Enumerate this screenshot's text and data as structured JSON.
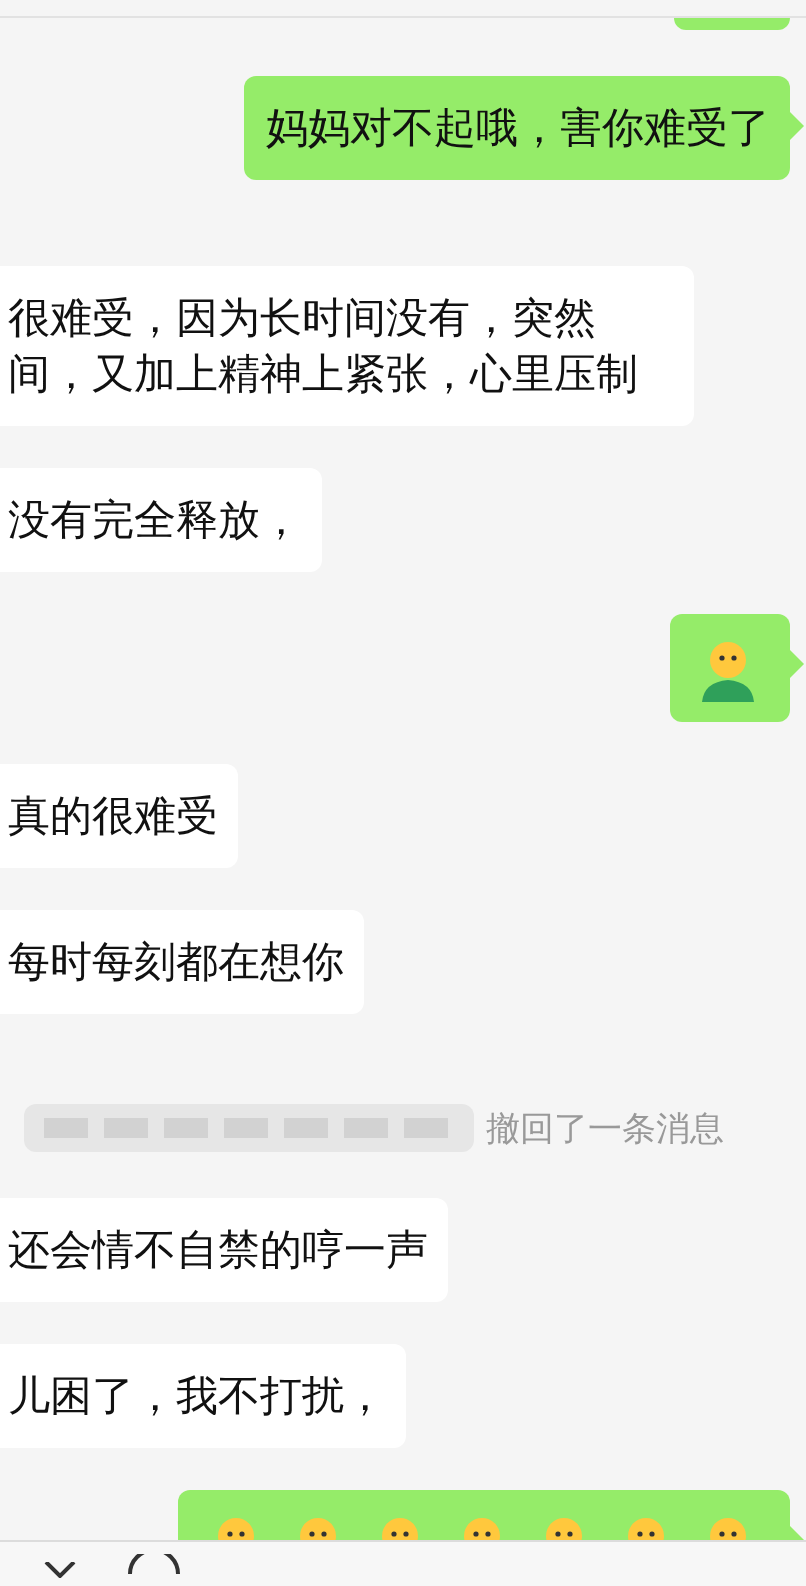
{
  "messages": [
    {
      "sent": true,
      "kind": "partial"
    },
    {
      "sent": true,
      "kind": "text",
      "text": "妈妈对不起哦，害你难受了"
    },
    {
      "sent": false,
      "kind": "text",
      "text": "很难受，因为长时间没有，突然间，又加上精神上紧张，心里压制"
    },
    {
      "sent": false,
      "kind": "text",
      "text": "没有完全释放，"
    },
    {
      "sent": true,
      "kind": "emoji",
      "emojis": [
        {
          "kind": "person"
        }
      ]
    },
    {
      "sent": false,
      "kind": "text",
      "text": "真的很难受"
    },
    {
      "sent": false,
      "kind": "text",
      "text": "每时每刻都在想你"
    },
    {
      "kind": "recall",
      "text": "撤回了一条消息"
    },
    {
      "sent": false,
      "kind": "text",
      "text": "还会情不自禁的哼一声"
    },
    {
      "sent": false,
      "kind": "text",
      "text": "儿困了，我不打扰，"
    },
    {
      "sent": true,
      "kind": "emoji",
      "emojis": [
        {
          "kind": "person"
        },
        {
          "kind": "person"
        },
        {
          "kind": "person"
        },
        {
          "kind": "person"
        },
        {
          "kind": "person"
        },
        {
          "kind": "person"
        },
        {
          "kind": "person"
        }
      ]
    }
  ]
}
